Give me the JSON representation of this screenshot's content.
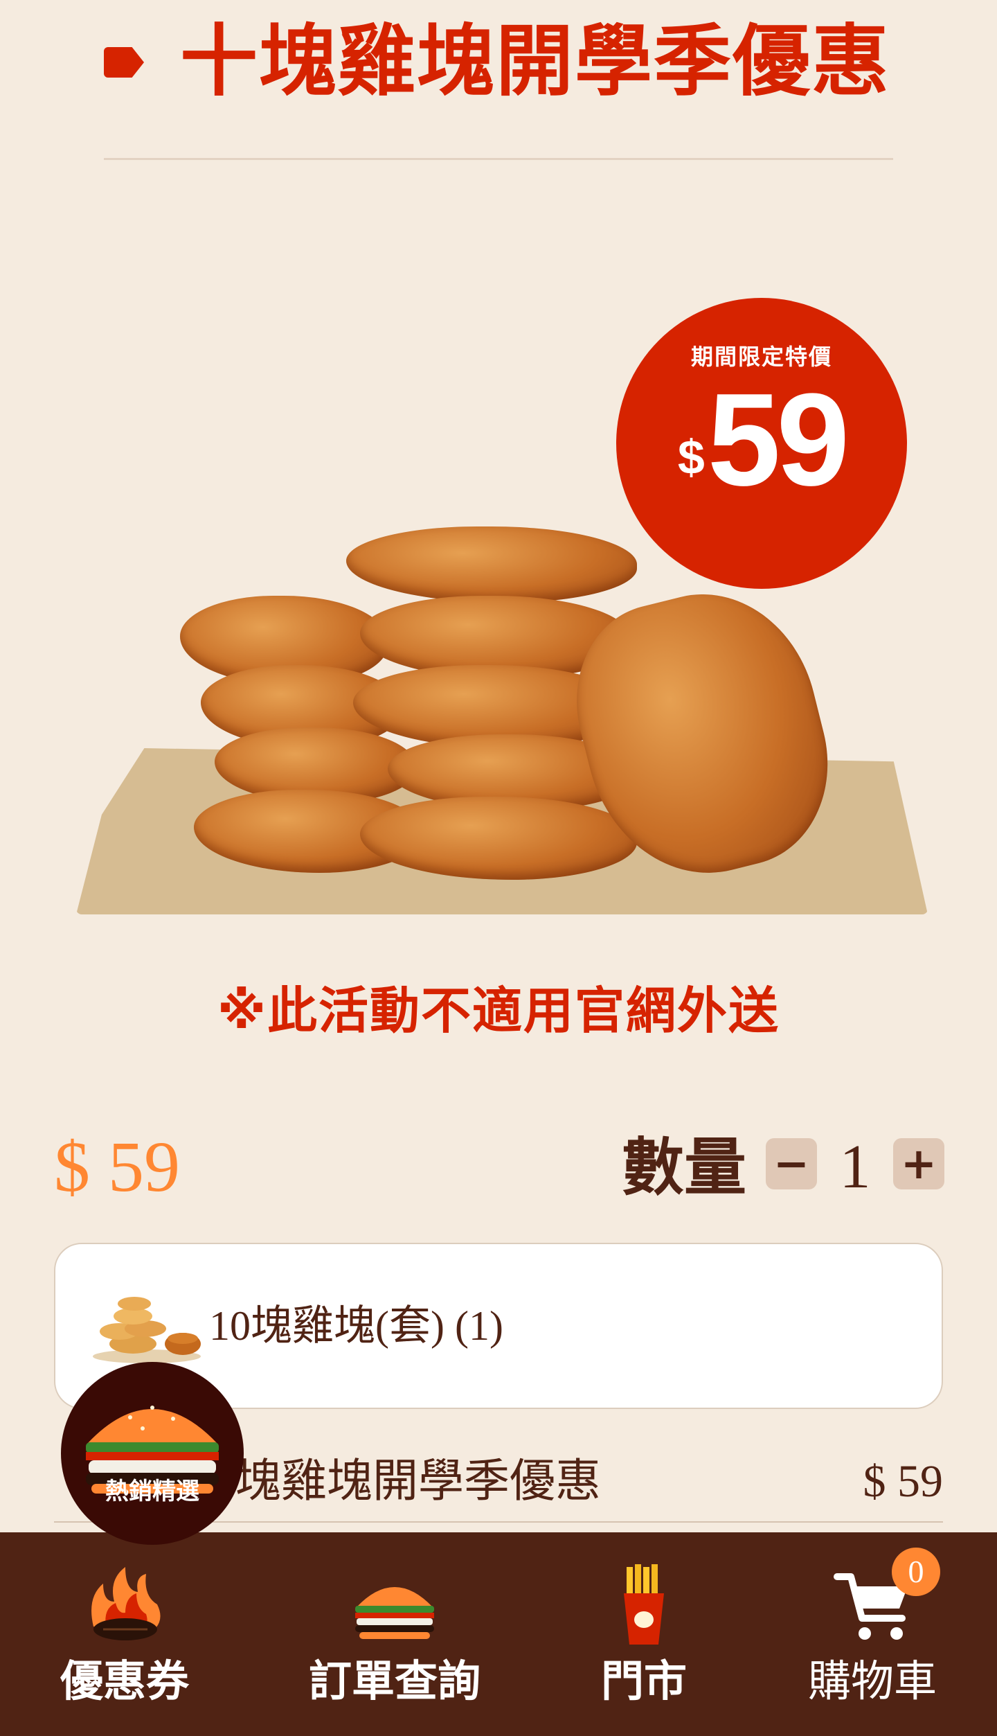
{
  "header": {
    "title": "十塊雞塊開學季優惠"
  },
  "promo": {
    "badge_label": "期間限定特價",
    "badge_currency": "$",
    "badge_price": "59",
    "notice": "※此活動不適用官網外送"
  },
  "product": {
    "price": "$ 59",
    "quantity_label": "數量",
    "quantity_minus": "−",
    "quantity": "1",
    "quantity_plus": "+"
  },
  "item_card": {
    "label": "10塊雞塊(套) (1)"
  },
  "summary": {
    "name": "塊雞塊開學季優惠",
    "price": "$ 59"
  },
  "fab": {
    "label": "熱銷精選"
  },
  "bottom_nav": {
    "items": [
      {
        "label": "優惠券",
        "icon": "flame-steak-icon"
      },
      {
        "label": "訂單查詢",
        "icon": "burger-icon"
      },
      {
        "label": "門市",
        "icon": "fries-icon"
      },
      {
        "label": "購物車",
        "icon": "cart-icon"
      }
    ],
    "cart_count": "0"
  },
  "colors": {
    "background": "#f5ebdf",
    "brand_red": "#d62300",
    "orange": "#ff8732",
    "brown": "#502314"
  }
}
